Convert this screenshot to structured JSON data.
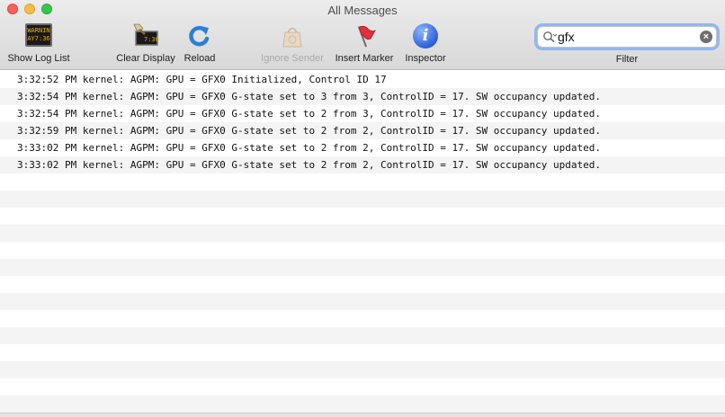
{
  "window": {
    "title": "All Messages"
  },
  "toolbar": {
    "show_log_list": "Show Log List",
    "clear_display": "Clear Display",
    "reload": "Reload",
    "ignore_sender": "Ignore Sender",
    "insert_marker": "Insert Marker",
    "inspector": "Inspector",
    "console_icon_text": "WARNIN AY7:36",
    "clear_icon_text": "7:36"
  },
  "search": {
    "value": "gfx",
    "label": "Filter"
  },
  "log": {
    "entries": [
      "3:32:52 PM kernel: AGPM: GPU = GFX0 Initialized, Control ID 17",
      "3:32:54 PM kernel: AGPM: GPU = GFX0 G-state set to 3 from 3, ControlID = 17. SW occupancy updated.",
      "3:32:54 PM kernel: AGPM: GPU = GFX0 G-state set to 2 from 3, ControlID = 17. SW occupancy updated.",
      "3:32:59 PM kernel: AGPM: GPU = GFX0 G-state set to 2 from 2, ControlID = 17. SW occupancy updated.",
      "3:33:02 PM kernel: AGPM: GPU = GFX0 G-state set to 2 from 2, ControlID = 17. SW occupancy updated.",
      "3:33:02 PM kernel: AGPM: GPU = GFX0 G-state set to 2 from 2, ControlID = 17. SW occupancy updated."
    ]
  }
}
